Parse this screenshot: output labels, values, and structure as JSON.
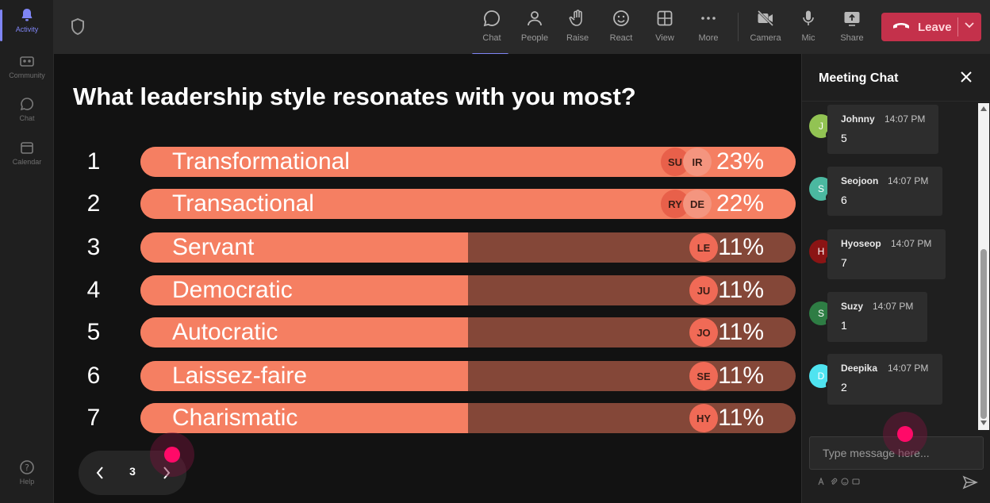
{
  "rail": {
    "items": [
      {
        "label": "Activity",
        "icon": "bell-icon",
        "active": true
      },
      {
        "label": "Community",
        "icon": "community-icon",
        "active": false
      },
      {
        "label": "Chat",
        "icon": "chat-icon",
        "active": false
      },
      {
        "label": "Calendar",
        "icon": "calendar-icon",
        "active": false
      }
    ],
    "help_label": "Help"
  },
  "toolbar": {
    "chat": "Chat",
    "people": "People",
    "raise": "Raise",
    "react": "React",
    "view": "View",
    "more": "More",
    "camera": "Camera",
    "mic": "Mic",
    "share": "Share",
    "leave": "Leave"
  },
  "poll": {
    "question": "What leadership style resonates with you most?",
    "options": [
      {
        "number": "1",
        "name": "Transformational",
        "percent_label": "23%",
        "percent": 23,
        "avatars": [
          "SU",
          "IR"
        ]
      },
      {
        "number": "2",
        "name": "Transactional",
        "percent_label": "22%",
        "percent": 22,
        "avatars": [
          "RY",
          "DE"
        ]
      },
      {
        "number": "3",
        "name": "Servant",
        "percent_label": "11%",
        "percent": 11,
        "avatars": [
          "LE"
        ]
      },
      {
        "number": "4",
        "name": "Democratic",
        "percent_label": "11%",
        "percent": 11,
        "avatars": [
          "JU"
        ]
      },
      {
        "number": "5",
        "name": "Autocratic",
        "percent_label": "11%",
        "percent": 11,
        "avatars": [
          "JO"
        ]
      },
      {
        "number": "6",
        "name": "Laissez-faire",
        "percent_label": "11%",
        "percent": 11,
        "avatars": [
          "SE"
        ]
      },
      {
        "number": "7",
        "name": "Charismatic",
        "percent_label": "11%",
        "percent": 11,
        "avatars": [
          "HY"
        ]
      }
    ],
    "fill_fraction_top": 1.0,
    "fill_fraction_rest": 0.5,
    "page": "3"
  },
  "chat": {
    "title": "Meeting Chat",
    "messages": [
      {
        "initial": "J",
        "author": "Johnny",
        "time": "14:07 PM",
        "text": "5",
        "color": "#92c353"
      },
      {
        "initial": "S",
        "author": "Seojoon",
        "time": "14:07 PM",
        "text": "6",
        "color": "#4bb8a0"
      },
      {
        "initial": "H",
        "author": "Hyoseop",
        "time": "14:07 PM",
        "text": "7",
        "color": "#8b1414"
      },
      {
        "initial": "S",
        "author": "Suzy",
        "time": "14:07 PM",
        "text": "1",
        "color": "#2e7d44"
      },
      {
        "initial": "D",
        "author": "Deepika",
        "time": "14:07 PM",
        "text": "2",
        "color": "#4fe3f0"
      }
    ],
    "placeholder": "Type message here..."
  },
  "colors": {
    "accent": "#7f85f5",
    "leave": "#c4314b",
    "bar_fill": "#f57f62",
    "bar_track": "#844738",
    "cursor": "#ff0a68"
  }
}
